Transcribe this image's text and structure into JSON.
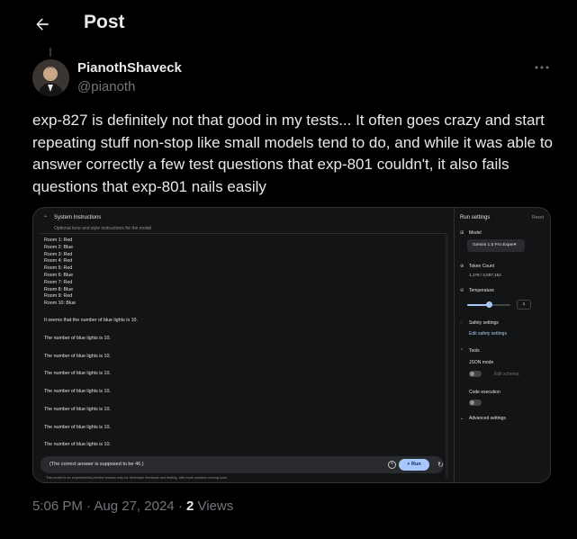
{
  "header": {
    "title": "Post"
  },
  "post": {
    "author_name": "PianothShaveck",
    "author_handle": "@pianoth",
    "text": "exp-827 is definitely not that good in my tests... It often goes crazy and start repeating stuff non-stop like small models tend to do, and while it was able to answer correctly a few test questions that exp-801 couldn't, it also fails questions that exp-801 nails easily",
    "time": "5:06 PM",
    "sep1": "·",
    "date": "Aug 27, 2024",
    "sep2": "·",
    "views_count": "2",
    "views_label": "Views"
  },
  "screenshot": {
    "system_instructions_title": "System Instructions",
    "system_instructions_hint": "Optional tone and style instructions for the model",
    "rooms": [
      "Room 1: Red",
      "Room 2: Blue",
      "Room 3: Red",
      "Room 4: Red",
      "Room 5: Red",
      "Room 6: Blue",
      "Room 7: Red",
      "Room 8: Blue",
      "Room 9: Red",
      "Room 10: Blue"
    ],
    "summary_line": "It seems that the number of blue lights is 10.",
    "repeat_lines": [
      "The number of blue lights is 10.",
      "The number of blue lights is 10.",
      "The number of blue lights is 10.",
      "The number of blue lights is 10.",
      "The number of blue lights is 10.",
      "The number of blue lights is 10.",
      "The number of blue lights is 10."
    ],
    "prompt_text": "(The correct answer is supposed to be 46.)",
    "run_label": "+ Run",
    "disclaimer": "This model is an experimental preview release only for developer feedback and testing, with more updates coming soon.",
    "run_settings": {
      "title": "Run settings",
      "reset": "Reset",
      "model_label": "Model",
      "model_value": "Gemini 1.5 Pro Exper▾",
      "token_label": "Token Count",
      "token_value": "1,179 / 2,097,152",
      "temperature_label": "Temperature",
      "temperature_value": "1",
      "temperature_fraction": 0.5,
      "safety_label": "Safety settings",
      "safety_link": "Edit safety settings",
      "tools_label": "Tools",
      "json_label": "JSON mode",
      "edit_schema": "Edit schema",
      "code_label": "Code execution",
      "advanced_label": "Advanced settings"
    }
  }
}
